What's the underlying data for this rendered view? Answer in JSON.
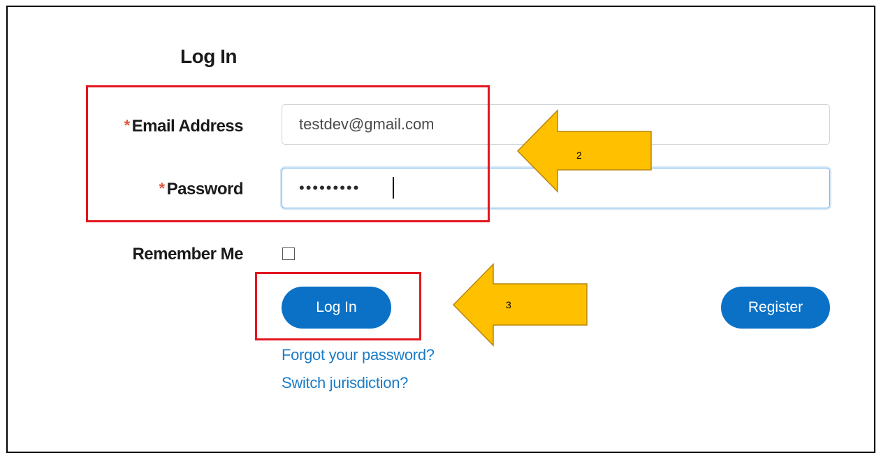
{
  "form": {
    "title": "Log In",
    "required_marker": "*",
    "email_label": "Email Address",
    "email_value": "testdev@gmail.com",
    "password_label": "Password",
    "password_value": "•••••••••",
    "remember_label": "Remember Me",
    "remember_checked": false,
    "login_button": "Log In",
    "register_button": "Register",
    "forgot_link": "Forgot your password?",
    "switch_link": "Switch jurisdiction?"
  },
  "annotations": {
    "step_2": "2",
    "step_3": "3",
    "highlight_color": "#e3161f",
    "arrow_color": "#ffc000"
  },
  "colors": {
    "primary": "#0b71c6",
    "link": "#1a7cc7",
    "required": "#e0543b"
  }
}
